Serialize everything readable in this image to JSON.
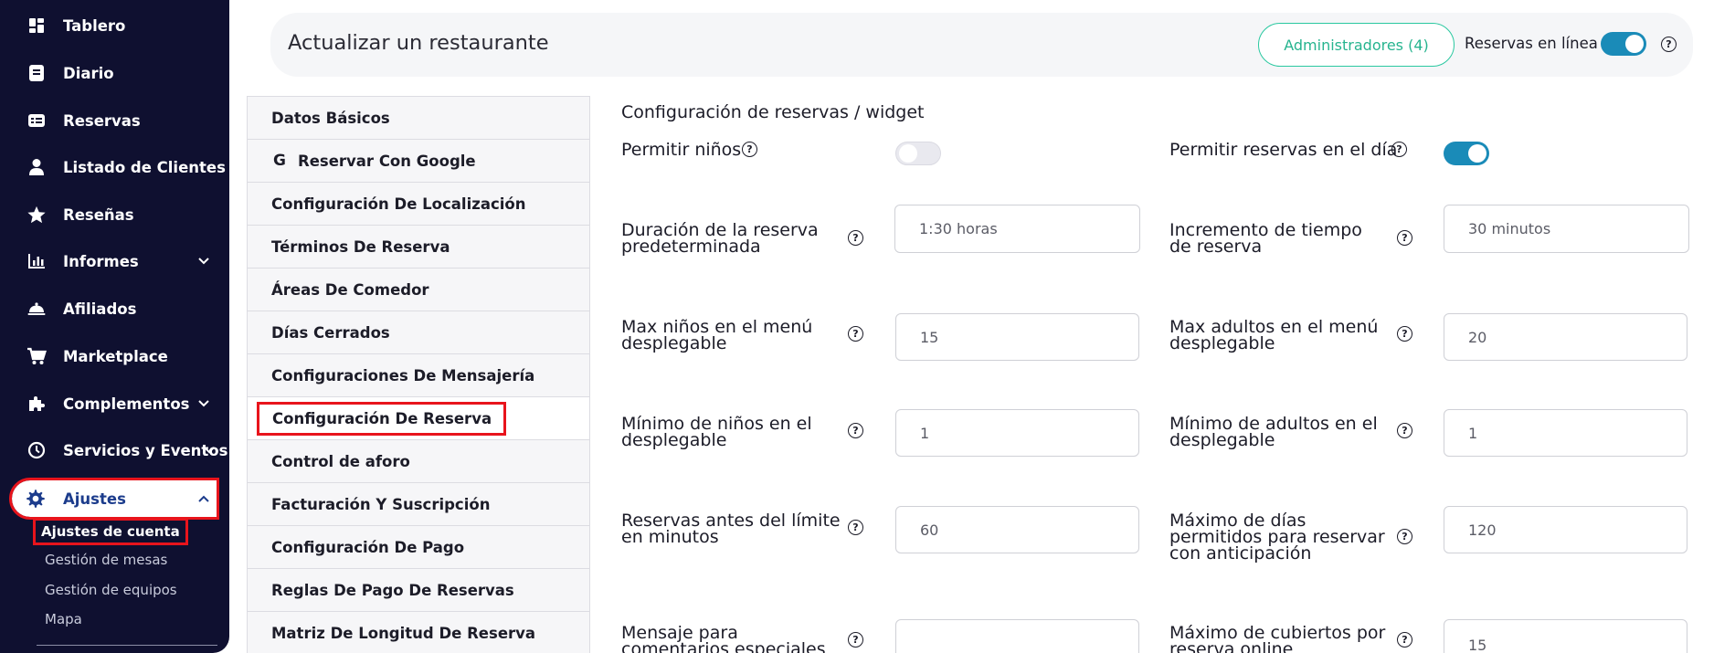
{
  "sidebar": {
    "items": [
      {
        "label": "Tablero",
        "icon": "dashboard-icon"
      },
      {
        "label": "Diario",
        "icon": "book-icon"
      },
      {
        "label": "Reservas",
        "icon": "ticket-icon"
      },
      {
        "label": "Listado de Clientes",
        "icon": "user-icon"
      },
      {
        "label": "Reseñas",
        "icon": "star-icon"
      },
      {
        "label": "Informes",
        "icon": "bar-chart-icon"
      },
      {
        "label": "Afiliados",
        "icon": "cloche-icon"
      },
      {
        "label": "Marketplace",
        "icon": "cart-icon"
      },
      {
        "label": "Complementos",
        "icon": "puzzle-icon"
      },
      {
        "label": "Servicios y Eventos",
        "icon": "clock-icon"
      },
      {
        "label": "Ajustes",
        "icon": "gear-icon"
      }
    ],
    "submenu": [
      "Ajustes de cuenta",
      "Gestión de mesas",
      "Gestión de equipos",
      "Mapa"
    ]
  },
  "header": {
    "title": "Actualizar un restaurante",
    "admins_button": "Administradores (4)",
    "online_label": "Reservas en línea",
    "online_enabled": true
  },
  "settings_menu": [
    "Datos Básicos",
    "Reservar Con Google",
    "Configuración De Localización",
    "Términos De Reserva",
    "Áreas De Comedor",
    "Días Cerrados",
    "Configuraciones De Mensajería",
    "Configuración De Reserva",
    "Control de aforo",
    "Facturación Y Suscripción",
    "Configuración De Pago",
    "Reglas De Pago De Reservas",
    "Matriz De Longitud De Reserva"
  ],
  "form": {
    "section_title": "Configuración de reservas / widget",
    "allow_children_label": "Permitir niños",
    "allow_children": false,
    "allow_same_day_label": "Permitir reservas en el día",
    "allow_same_day": true,
    "fields": {
      "duration_label": "Duración de la reserva predeterminada",
      "duration_value": "1:30 horas",
      "increment_label": "Incremento de tiempo de reserva",
      "increment_value": "30 minutos",
      "max_children_label": "Max niños en el menú desplegable",
      "max_children_value": "15",
      "max_adults_label": "Max adultos en el menú desplegable",
      "max_adults_value": "20",
      "min_children_label": "Mínimo de niños en el desplegable",
      "min_children_value": "1",
      "min_adults_label": "Mínimo de adultos en el desplegable",
      "min_adults_value": "1",
      "before_limit_label": "Reservas antes del límite en minutos",
      "before_limit_value": "60",
      "max_days_label": "Máximo de días permitidos para reservar con anticipación",
      "max_days_value": "120",
      "special_comments_label": "Mensaje para comentarios especiales",
      "special_comments_value": "",
      "max_covers_label": "Máximo de cubiertos por reserva online",
      "max_covers_value": "15"
    }
  }
}
